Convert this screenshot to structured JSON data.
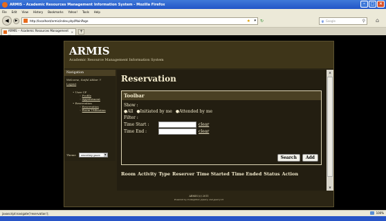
{
  "window": {
    "title": "ARMIS - Academic Resources Management Information System - Mozilla Firefox"
  },
  "menubar": [
    "File",
    "Edit",
    "View",
    "History",
    "Bookmarks",
    "Yahoo!",
    "Tools",
    "Help"
  ],
  "nav": {
    "url": "http://localhost/armis/index.php/MainPage",
    "search_placeholder": "Google"
  },
  "tab": {
    "label": "ARMIS -- Academic Resources Management ..."
  },
  "app": {
    "title": "ARMIS",
    "subtitle": "Academic Resource Management Information System"
  },
  "sidebar": {
    "heading": "Navigation",
    "welcome": "Welcome, Saiful Akbar !!",
    "logout": "Logout",
    "user_cp": "User CP",
    "profile": "Profile",
    "appointment": "Appointment",
    "reservation": "Reservation",
    "reservation_link": "Reservation",
    "room_utilization": "Room Utilization",
    "theme_label": "Theme",
    "theme_value": "sweetiry-pure"
  },
  "main": {
    "title": "Reservation",
    "toolbar_title": "Toolbar",
    "show_label": "Show :",
    "show_options": [
      "All",
      "Initiated by me",
      "Attended by me"
    ],
    "filter_label": "Filter :",
    "time_start_label": "Time Start :",
    "time_end_label": "Time End :",
    "clear": "clear",
    "search_button": "Search",
    "add_button": "Add",
    "columns": [
      "Room",
      "Activity",
      "Type",
      "Reserver",
      "Time Started",
      "Time Ended",
      "Status",
      "Action"
    ]
  },
  "footer": {
    "line1": "ARMIS (c) 2011",
    "line2": "Powered by Codeigniter, jQuery, and jquery UI"
  },
  "statusbar": {
    "text": "javascript:navigate('reservation');",
    "zoom": "100%"
  },
  "colors": {
    "page_bg": "#000000",
    "panel_bg": "#2b2514",
    "header_bg": "#3e3519",
    "text_light": "#f5edcf",
    "titlebar": "#2255c7"
  }
}
